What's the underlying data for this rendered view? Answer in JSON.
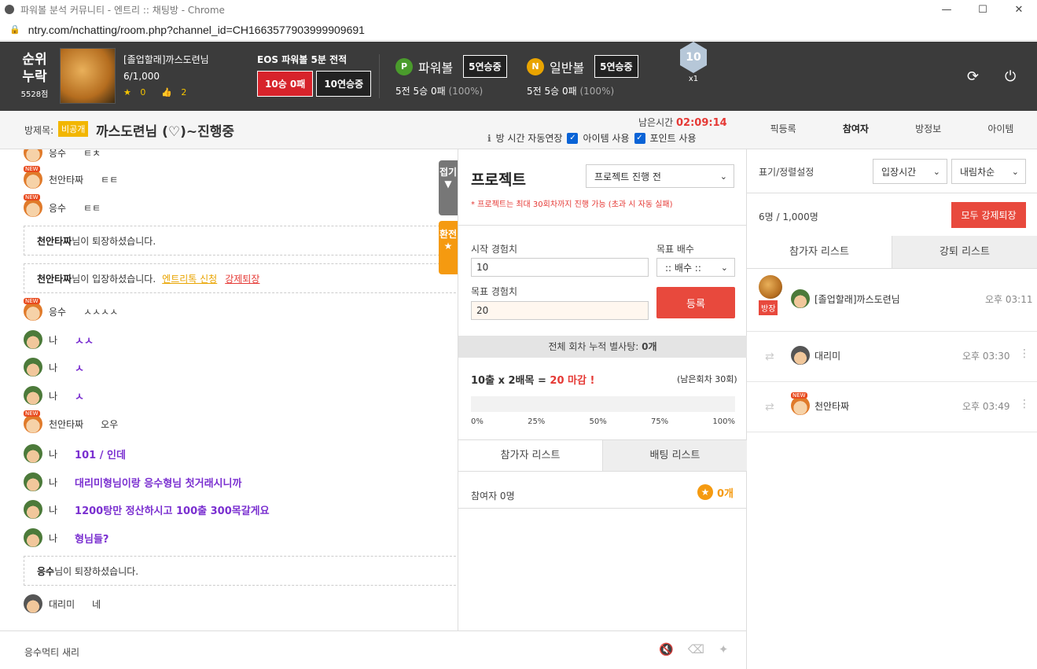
{
  "browser": {
    "title": "파워볼 분석 커뮤니티 - 엔트리 :: 채팅방 - Chrome",
    "url": "ntry.com/nchatting/room.php?channel_id=CH1663577903999909691",
    "min": "—",
    "max": "☐",
    "close": "✕",
    "lock": "🔒"
  },
  "topbar": {
    "rank_label": "순위",
    "rank_sub": "누락",
    "points": "5528점",
    "user_name": "[졸업할래]까스도련님",
    "level": "6/1,000",
    "stars": "0",
    "likes": "2",
    "star_icon": "★",
    "like_icon": "👍",
    "eos_title": "EOS 파워볼 5분 전적",
    "eos_record": "10승 0패",
    "eos_streak": "10연승중",
    "powerball": {
      "icon": "P",
      "name": "파워볼",
      "streak": "5연승중",
      "record": "5전 5승 0패",
      "pct": "(100%)"
    },
    "normalball": {
      "icon": "N",
      "name": "일반볼",
      "streak": "5연승중",
      "record": "5전 5승 0패",
      "pct": "(100%)"
    },
    "medal_num": "10",
    "medal_mult": "x1",
    "refresh_icon": "⟳",
    "power_icon": "⏻"
  },
  "room": {
    "label": "방제목:",
    "private": "비공개",
    "title": "까스도련님 (♡)~진행중",
    "remain_label": "남은시간",
    "remain_time": "02:09:14",
    "info_icon": "ℹ",
    "auto_extend": "방 시간 자동연장",
    "item_use": "아이템 사용",
    "point_use": "포인트 사용",
    "check": "✓",
    "menu": [
      "픽등록",
      "참여자",
      "방정보",
      "아이템"
    ]
  },
  "chat": {
    "messages": [
      {
        "nick": "응수",
        "text": "ㅌㅊ"
      },
      {
        "nick": "천안타짜",
        "text": "ㅌㅌ"
      },
      {
        "nick": "응수",
        "text": "ㅌㅌ"
      },
      {
        "nick": "응수",
        "text": "ㅅㅅㅅㅅ"
      },
      {
        "nick": "나",
        "text": "ㅅㅅ"
      },
      {
        "nick": "나",
        "text": "ㅅ"
      },
      {
        "nick": "나",
        "text": "ㅅ"
      },
      {
        "nick": "천안타짜",
        "text": "오우"
      },
      {
        "nick": "나",
        "text": "101 / 인데"
      },
      {
        "nick": "나",
        "text": "대리미형님이랑 응수형님 첫거래시니까"
      },
      {
        "nick": "나",
        "text": "1200탕만 정산하시고 100출 300목갈게요"
      },
      {
        "nick": "나",
        "text": "형님들?"
      },
      {
        "nick": "대리미",
        "text": "네"
      }
    ],
    "sys1": {
      "name": "천안타짜",
      "text": "님이 퇴장하셨습니다."
    },
    "sys2": {
      "name": "천안타짜",
      "text": "님이 입장하셨습니다.",
      "link1": "엔트리톡 신청",
      "link2": "강제퇴장"
    },
    "sys3": {
      "name": "응수",
      "text": "님이 퇴장하셨습니다."
    },
    "fold_tab": "접기",
    "fold_arrow": "▼",
    "swap_tab": "환전",
    "swap_star": "★",
    "input_text": "응수먹티 새리",
    "mute_icon": "🔇",
    "eraser_icon": "⌫",
    "magic_icon": "✦"
  },
  "project": {
    "title": "프로젝트",
    "status": "프로젝트 진행 전",
    "chevron": "⌄",
    "note": "* 프로젝트는 최대 30회차까지 진행 가능 (초과 시 자동 실패)",
    "start_label": "시작 경험치",
    "start_value": "10",
    "goal_label": "목표 경험치",
    "goal_value": "20",
    "mult_label": "목표 배수",
    "mult_value": ":: 배수 ::",
    "register": "등록",
    "accum_label": "전체 회차 누적 별사탕:",
    "accum_value": "0개",
    "bet_main": "10출 x 2배목 =",
    "bet_result": "20 마감 !",
    "bet_remain": "(남은회차 30회)",
    "progress": 0,
    "ticks": [
      "0%",
      "25%",
      "50%",
      "75%",
      "100%"
    ],
    "tabs": [
      "참가자 리스트",
      "배팅 리스트"
    ],
    "participants": "참여자 0명",
    "stars": "0개",
    "star_icon": "★"
  },
  "plist": {
    "sort_label": "표기/정렬설정",
    "sort_by": "입장시간",
    "order": "내림차순",
    "chevron": "⌄",
    "count": "6명 / 1,000명",
    "kick_all": "모두 강제퇴장",
    "tabs": [
      "참가자 리스트",
      "강퇴 리스트"
    ],
    "host_badge": "방장",
    "swap_icon": "⇄",
    "more_icon": "⋮",
    "rows": [
      {
        "name": "[졸업할래]까스도련님",
        "time": "오후 03:11"
      },
      {
        "name": "대리미",
        "time": "오후 03:30"
      },
      {
        "name": "천안타짜",
        "time": "오후 03:49"
      }
    ]
  }
}
